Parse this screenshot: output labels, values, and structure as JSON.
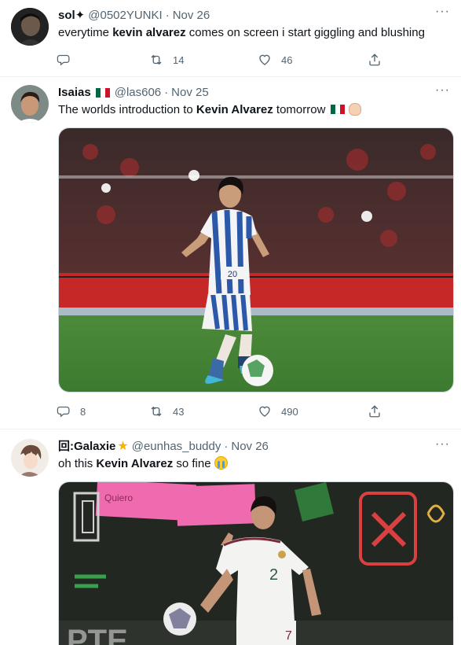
{
  "tweets": [
    {
      "display_name": "sol✦",
      "handle": "@0502YUNKI",
      "time": "Nov 26",
      "text_parts": {
        "a": "everytime ",
        "b": "kevin alvarez",
        "c": " comes on screen i start giggling and blushing"
      },
      "reply_count": "",
      "retweet_count": "14",
      "like_count": "46"
    },
    {
      "display_name": "Isaias",
      "handle": "@las606",
      "time": "Nov 25",
      "text_parts": {
        "a": "The worlds introduction to ",
        "b": "Kevin Alvarez",
        "c": " tomorrow "
      },
      "reply_count": "8",
      "retweet_count": "43",
      "like_count": "490",
      "jersey_number": "20"
    },
    {
      "display_name": "回:Galaxie",
      "handle": "@eunhas_buddy",
      "time": "Nov 26",
      "text_parts": {
        "a": "oh this ",
        "b": "Kevin Alvarez",
        "c": " so fine "
      },
      "sign_text": "Quiero"
    }
  ],
  "icons": {
    "reply": "reply-icon",
    "retweet": "retweet-icon",
    "like": "heart-icon",
    "share": "share-icon",
    "more": "more-icon",
    "flag": "mexico-flag-icon",
    "hand": "pinched-fingers-emoji",
    "crying": "crying-face-emoji",
    "star": "star-emoji"
  },
  "colors": {
    "text": "#0f1419",
    "secondary": "#536471",
    "divider": "#eff3f4",
    "flag_green": "#006847",
    "flag_red": "#ce1126"
  }
}
